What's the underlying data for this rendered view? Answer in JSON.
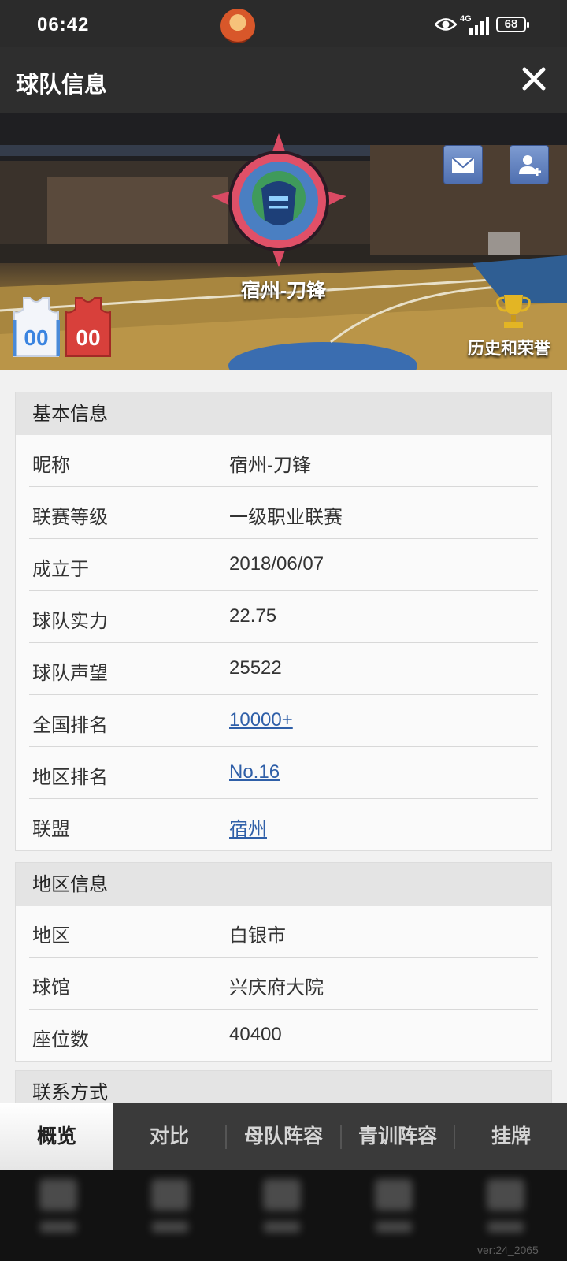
{
  "status_bar": {
    "time": "06:42",
    "network": "4G",
    "battery": "68"
  },
  "header": {
    "title": "球队信息",
    "close_icon": "close-icon"
  },
  "banner": {
    "team_name": "宿州-刀锋",
    "home_jersey_number": "00",
    "away_jersey_number": "00",
    "history_label": "历史和荣誉",
    "mail_icon": "mail-icon",
    "add_friend_icon": "add-friend-icon"
  },
  "basic_info": {
    "header": "基本信息",
    "rows": [
      {
        "label": "昵称",
        "value": "宿州-刀锋"
      },
      {
        "label": "联赛等级",
        "value": "一级职业联赛"
      },
      {
        "label": "成立于",
        "value": "2018/06/07"
      },
      {
        "label": "球队实力",
        "value": "22.75"
      },
      {
        "label": "球队声望",
        "value": "25522"
      },
      {
        "label": "全国排名",
        "value": "10000+"
      },
      {
        "label": "地区排名",
        "value": "No.16"
      },
      {
        "label": "联盟",
        "value": "宿州"
      }
    ]
  },
  "region_info": {
    "header": "地区信息",
    "rows": [
      {
        "label": "地区",
        "value": "白银市"
      },
      {
        "label": "球馆",
        "value": "兴庆府大院"
      },
      {
        "label": "座位数",
        "value": "40400"
      }
    ]
  },
  "contact_info": {
    "header": "联系方式"
  },
  "tabs": [
    {
      "label": "概览",
      "active": true
    },
    {
      "label": "对比",
      "active": false
    },
    {
      "label": "母队阵容",
      "active": false
    },
    {
      "label": "青训阵容",
      "active": false
    },
    {
      "label": "挂牌",
      "active": false
    }
  ],
  "version": "ver:24_2065",
  "colors": {
    "link": "#2f5fa8",
    "header_bg": "#2e2e2e",
    "panel_header_bg": "#e4e4e4"
  }
}
